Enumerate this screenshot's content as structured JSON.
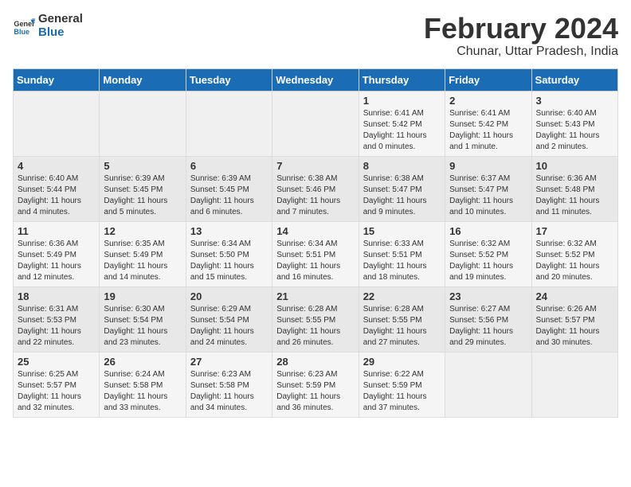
{
  "header": {
    "logo_line1": "General",
    "logo_line2": "Blue",
    "month_title": "February 2024",
    "location": "Chunar, Uttar Pradesh, India"
  },
  "weekdays": [
    "Sunday",
    "Monday",
    "Tuesday",
    "Wednesday",
    "Thursday",
    "Friday",
    "Saturday"
  ],
  "weeks": [
    [
      {
        "day": "",
        "info": ""
      },
      {
        "day": "",
        "info": ""
      },
      {
        "day": "",
        "info": ""
      },
      {
        "day": "",
        "info": ""
      },
      {
        "day": "1",
        "info": "Sunrise: 6:41 AM\nSunset: 5:42 PM\nDaylight: 11 hours and 0 minutes."
      },
      {
        "day": "2",
        "info": "Sunrise: 6:41 AM\nSunset: 5:42 PM\nDaylight: 11 hours and 1 minute."
      },
      {
        "day": "3",
        "info": "Sunrise: 6:40 AM\nSunset: 5:43 PM\nDaylight: 11 hours and 2 minutes."
      }
    ],
    [
      {
        "day": "4",
        "info": "Sunrise: 6:40 AM\nSunset: 5:44 PM\nDaylight: 11 hours and 4 minutes."
      },
      {
        "day": "5",
        "info": "Sunrise: 6:39 AM\nSunset: 5:45 PM\nDaylight: 11 hours and 5 minutes."
      },
      {
        "day": "6",
        "info": "Sunrise: 6:39 AM\nSunset: 5:45 PM\nDaylight: 11 hours and 6 minutes."
      },
      {
        "day": "7",
        "info": "Sunrise: 6:38 AM\nSunset: 5:46 PM\nDaylight: 11 hours and 7 minutes."
      },
      {
        "day": "8",
        "info": "Sunrise: 6:38 AM\nSunset: 5:47 PM\nDaylight: 11 hours and 9 minutes."
      },
      {
        "day": "9",
        "info": "Sunrise: 6:37 AM\nSunset: 5:47 PM\nDaylight: 11 hours and 10 minutes."
      },
      {
        "day": "10",
        "info": "Sunrise: 6:36 AM\nSunset: 5:48 PM\nDaylight: 11 hours and 11 minutes."
      }
    ],
    [
      {
        "day": "11",
        "info": "Sunrise: 6:36 AM\nSunset: 5:49 PM\nDaylight: 11 hours and 12 minutes."
      },
      {
        "day": "12",
        "info": "Sunrise: 6:35 AM\nSunset: 5:49 PM\nDaylight: 11 hours and 14 minutes."
      },
      {
        "day": "13",
        "info": "Sunrise: 6:34 AM\nSunset: 5:50 PM\nDaylight: 11 hours and 15 minutes."
      },
      {
        "day": "14",
        "info": "Sunrise: 6:34 AM\nSunset: 5:51 PM\nDaylight: 11 hours and 16 minutes."
      },
      {
        "day": "15",
        "info": "Sunrise: 6:33 AM\nSunset: 5:51 PM\nDaylight: 11 hours and 18 minutes."
      },
      {
        "day": "16",
        "info": "Sunrise: 6:32 AM\nSunset: 5:52 PM\nDaylight: 11 hours and 19 minutes."
      },
      {
        "day": "17",
        "info": "Sunrise: 6:32 AM\nSunset: 5:52 PM\nDaylight: 11 hours and 20 minutes."
      }
    ],
    [
      {
        "day": "18",
        "info": "Sunrise: 6:31 AM\nSunset: 5:53 PM\nDaylight: 11 hours and 22 minutes."
      },
      {
        "day": "19",
        "info": "Sunrise: 6:30 AM\nSunset: 5:54 PM\nDaylight: 11 hours and 23 minutes."
      },
      {
        "day": "20",
        "info": "Sunrise: 6:29 AM\nSunset: 5:54 PM\nDaylight: 11 hours and 24 minutes."
      },
      {
        "day": "21",
        "info": "Sunrise: 6:28 AM\nSunset: 5:55 PM\nDaylight: 11 hours and 26 minutes."
      },
      {
        "day": "22",
        "info": "Sunrise: 6:28 AM\nSunset: 5:55 PM\nDaylight: 11 hours and 27 minutes."
      },
      {
        "day": "23",
        "info": "Sunrise: 6:27 AM\nSunset: 5:56 PM\nDaylight: 11 hours and 29 minutes."
      },
      {
        "day": "24",
        "info": "Sunrise: 6:26 AM\nSunset: 5:57 PM\nDaylight: 11 hours and 30 minutes."
      }
    ],
    [
      {
        "day": "25",
        "info": "Sunrise: 6:25 AM\nSunset: 5:57 PM\nDaylight: 11 hours and 32 minutes."
      },
      {
        "day": "26",
        "info": "Sunrise: 6:24 AM\nSunset: 5:58 PM\nDaylight: 11 hours and 33 minutes."
      },
      {
        "day": "27",
        "info": "Sunrise: 6:23 AM\nSunset: 5:58 PM\nDaylight: 11 hours and 34 minutes."
      },
      {
        "day": "28",
        "info": "Sunrise: 6:23 AM\nSunset: 5:59 PM\nDaylight: 11 hours and 36 minutes."
      },
      {
        "day": "29",
        "info": "Sunrise: 6:22 AM\nSunset: 5:59 PM\nDaylight: 11 hours and 37 minutes."
      },
      {
        "day": "",
        "info": ""
      },
      {
        "day": "",
        "info": ""
      }
    ]
  ]
}
